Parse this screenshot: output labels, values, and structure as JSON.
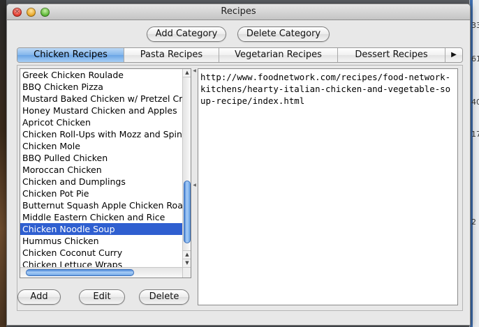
{
  "window": {
    "title": "Recipes"
  },
  "toolbar": {
    "add_category": "Add Category",
    "delete_category": "Delete Category"
  },
  "tabs": [
    {
      "label": "Chicken Recipes",
      "active": true
    },
    {
      "label": "Pasta Recipes"
    },
    {
      "label": "Vegetarian Recipes"
    },
    {
      "label": "Dessert Recipes"
    }
  ],
  "tab_overflow_icon": "right-triangle-icon",
  "recipes": {
    "items": [
      "Greek Chicken Roulade",
      "BBQ Chicken Pizza",
      "Mustard Baked Chicken w/ Pretzel Crust",
      "Honey Mustard Chicken and Apples",
      "Apricot Chicken",
      "Chicken Roll-Ups with Mozz and Spinach",
      "Chicken Mole",
      "BBQ Pulled Chicken",
      "Moroccan Chicken",
      "Chicken and Dumplings",
      "Chicken Pot Pie",
      "Butternut Squash Apple Chicken Roast",
      "Middle Eastern Chicken and Rice",
      "Chicken Noodle Soup",
      "Hummus Chicken",
      "Chicken Coconut Curry",
      "Chicken Lettuce Wraps"
    ],
    "selected": "Chicken Noodle Soup"
  },
  "buttons": {
    "add": "Add",
    "edit": "Edit",
    "delete": "Delete"
  },
  "detail": {
    "url": "http://www.foodnetwork.com/recipes/food-network-kitchens/hearty-italian-chicken-and-vegetable-soup-recipe/index.html"
  },
  "background_window": {
    "numbers": [
      "33",
      "61",
      "40",
      "17",
      "2"
    ]
  },
  "colors": {
    "selection": "#2f5fd0",
    "tab_active": "#83b6ec"
  }
}
